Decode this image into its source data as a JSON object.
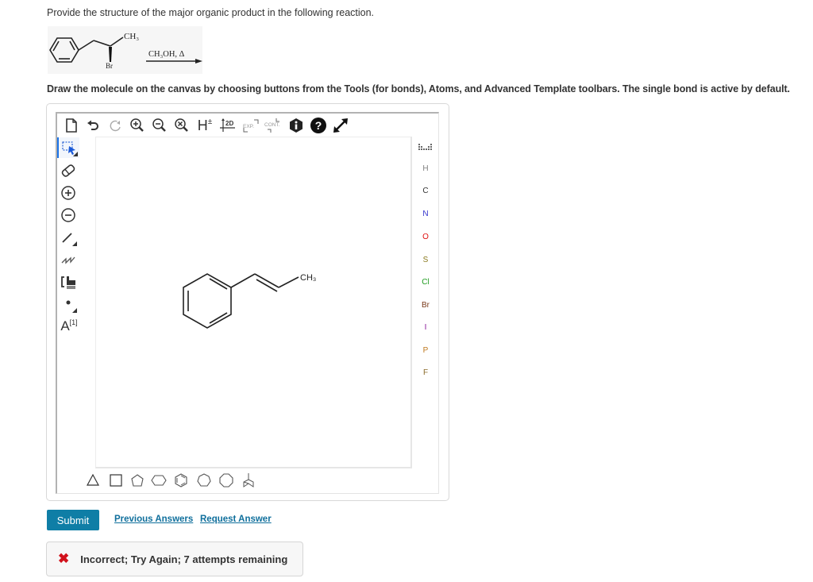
{
  "question": {
    "prompt": "Provide the structure of the major organic product in the following reaction.",
    "reaction": {
      "substituent_top": "CH3",
      "substituent_bottom": "Br",
      "reagent": "CH3OH, Δ"
    },
    "instructions": "Draw the molecule on the canvas by choosing buttons from the Tools (for bonds), Atoms, and Advanced Template toolbars. The single bond is active by default."
  },
  "editor": {
    "top_toolbar": [
      {
        "name": "new-document",
        "icon": "document-icon"
      },
      {
        "name": "undo",
        "icon": "undo-icon"
      },
      {
        "name": "redo",
        "icon": "redo-icon"
      },
      {
        "name": "zoom-in",
        "icon": "zoom-in-icon"
      },
      {
        "name": "zoom-out",
        "icon": "zoom-out-icon"
      },
      {
        "name": "zoom-reset",
        "icon": "zoom-reset-icon"
      },
      {
        "name": "hydrogens",
        "icon": "h-plus-minus-icon",
        "label": "H±"
      },
      {
        "name": "clean-2d",
        "icon": "clean-2d-icon",
        "label": "2D"
      },
      {
        "name": "expand",
        "icon": "expand-icon",
        "label": "EXP."
      },
      {
        "name": "contract",
        "icon": "contract-icon",
        "label": "CONT."
      },
      {
        "name": "info",
        "icon": "info-icon"
      },
      {
        "name": "help",
        "icon": "help-icon"
      },
      {
        "name": "fullscreen",
        "icon": "fullscreen-icon"
      }
    ],
    "left_toolbar": [
      {
        "name": "select",
        "icon": "select-lasso-icon",
        "active": true
      },
      {
        "name": "erase",
        "icon": "eraser-icon"
      },
      {
        "name": "charge-plus",
        "icon": "charge-plus-icon"
      },
      {
        "name": "charge-minus",
        "icon": "charge-minus-icon"
      },
      {
        "name": "single-bond",
        "icon": "single-bond-icon"
      },
      {
        "name": "chain",
        "icon": "chain-icon"
      },
      {
        "name": "sgroup",
        "icon": "bracket-icon"
      },
      {
        "name": "radical",
        "icon": "radical-dot-icon"
      },
      {
        "name": "atom-map",
        "icon": "atom-map-icon",
        "label": "A",
        "sup": "[1]"
      }
    ],
    "atoms": [
      "H",
      "C",
      "N",
      "O",
      "S",
      "Cl",
      "Br",
      "I",
      "P",
      "F"
    ],
    "atom_colors": {
      "H": "#808080",
      "C": "#333333",
      "N": "#3333cc",
      "O": "#e01010",
      "S": "#8a7a1f",
      "Cl": "#1f9c1f",
      "Br": "#7a3a1a",
      "I": "#8a1a9a",
      "P": "#c07a20",
      "F": "#8a6a2a"
    },
    "periodic_table_icon": "periodic-table-icon",
    "templates": [
      "cyclopropane",
      "cyclobutane",
      "cyclopentane",
      "cyclohexane",
      "benzene",
      "cycloheptane",
      "cyclooctane",
      "bicyclic"
    ],
    "canvas_molecule": {
      "description": "trans-1-phenylpropene",
      "label": "CH3"
    }
  },
  "actions": {
    "submit": "Submit",
    "previous_answers": "Previous Answers",
    "request_answer": "Request Answer"
  },
  "feedback": {
    "status": "incorrect",
    "message": "Incorrect; Try Again; 7 attempts remaining"
  },
  "colors": {
    "submit_bg": "#0f7ea6",
    "link": "#0f6f9c",
    "error": "#d1111c",
    "active_tool": "#1a73e8"
  }
}
